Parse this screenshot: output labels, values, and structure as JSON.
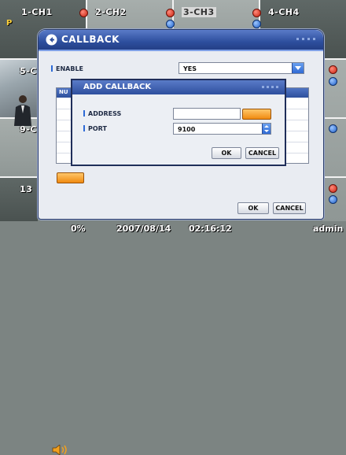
{
  "channels": [
    {
      "label": "1-CH1",
      "highlight": false
    },
    {
      "label": "2-CH2",
      "highlight": false
    },
    {
      "label": "3-CH3",
      "highlight": true
    },
    {
      "label": "4-CH4",
      "highlight": false
    }
  ],
  "partial_channel_labels": {
    "ch5": "5-C",
    "ch9": "9-C",
    "ch13": "13"
  },
  "p_flag": "P",
  "dialog": {
    "title": "CALLBACK",
    "enable_label": "ENABLE",
    "enable_value": "YES",
    "list_header_partial": "NU",
    "ok_label": "OK",
    "cancel_label": "CANCEL"
  },
  "sub_dialog": {
    "title": "ADD CALLBACK",
    "address_label": "ADDRESS",
    "address_value": "",
    "port_label": "PORT",
    "port_value": "9100",
    "ok_label": "OK",
    "cancel_label": "CANCEL"
  },
  "status": {
    "volume": "0%",
    "date": "2007/08/14",
    "time": "02:16:12",
    "user": "admin"
  },
  "colors": {
    "title_blue": "#2e4f9e",
    "accent_orange": "#f08a10",
    "rec_red": "#c8200e",
    "motion_blue": "#1f5fc8"
  },
  "icons": [
    "back-arrow-icon",
    "dropdown-arrow-icon",
    "keyboard-icon",
    "speaker-icon",
    "record-indicator-icon",
    "motion-indicator-icon"
  ]
}
